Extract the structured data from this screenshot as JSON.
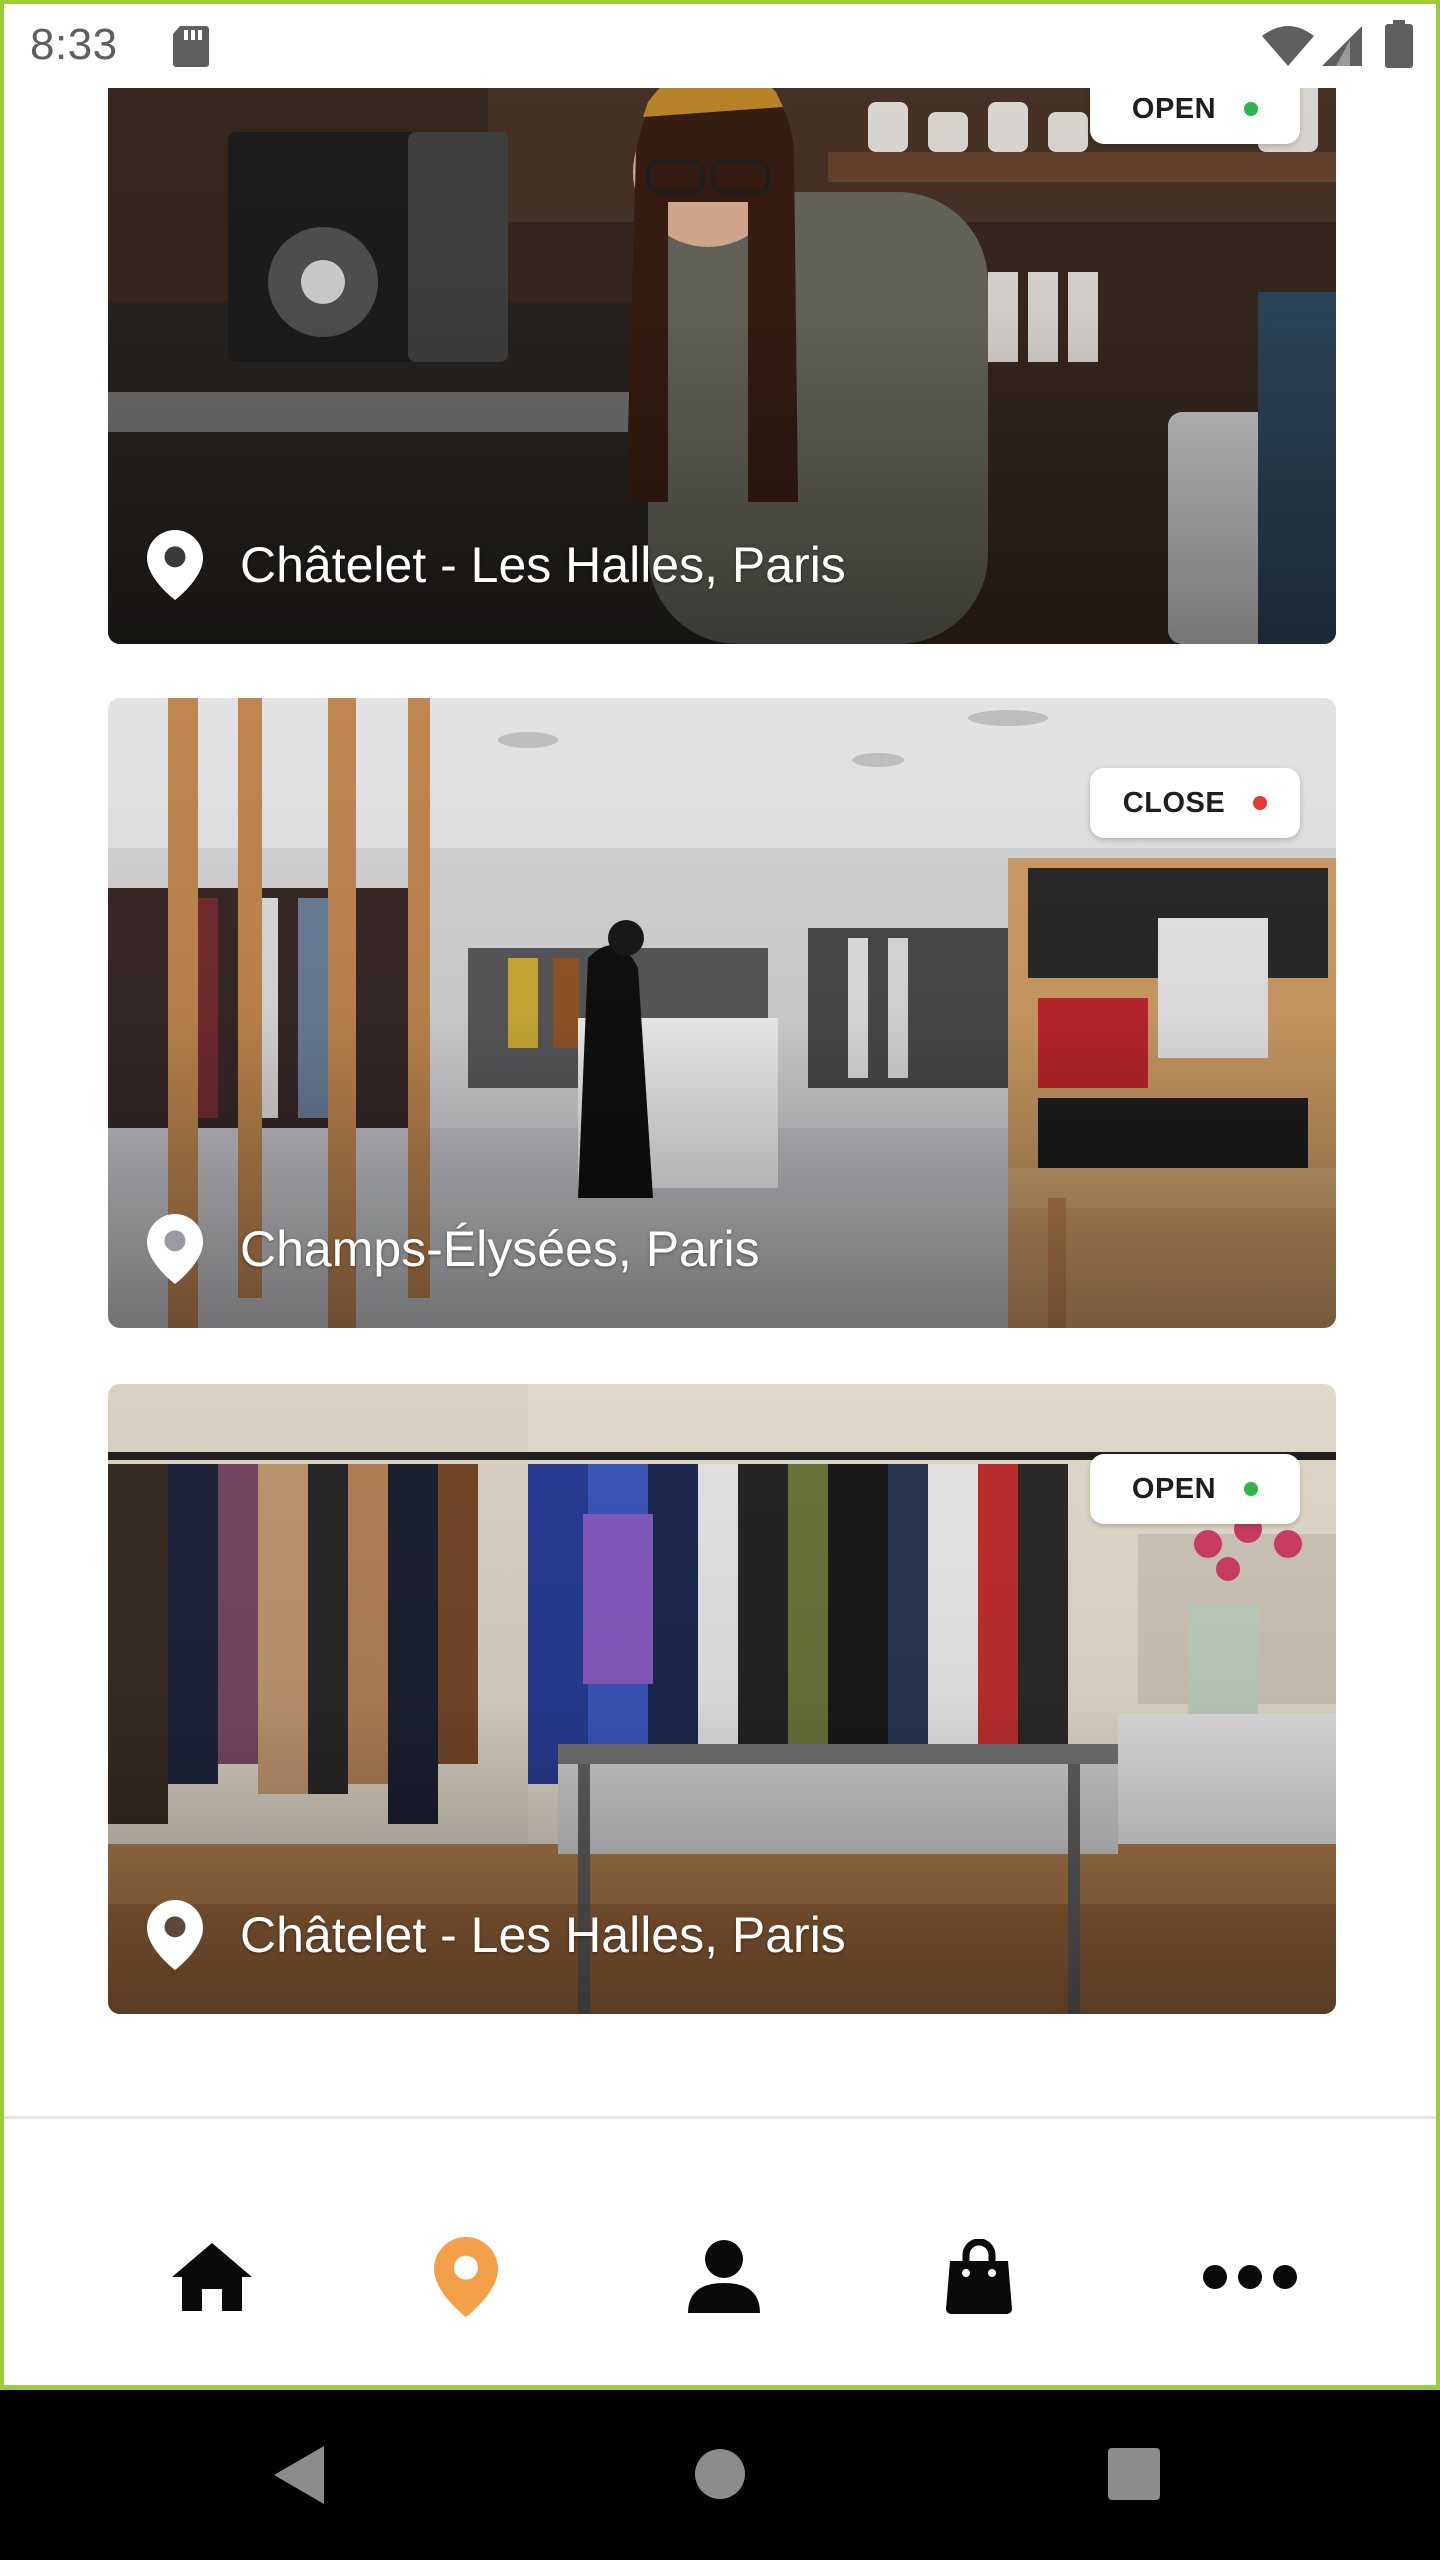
{
  "status_bar": {
    "time": "8:33",
    "icons": [
      "sd-card-icon",
      "wifi-icon",
      "cell-signal-icon",
      "battery-icon"
    ]
  },
  "stores": [
    {
      "location": "Châtelet - Les Halles, Paris",
      "status": "OPEN",
      "status_color": "#2fb34a",
      "image": "coffee-shop-barista-photo"
    },
    {
      "location": "Champs-Élysées, Paris",
      "status": "CLOSE",
      "status_color": "#e53935",
      "image": "clothing-boutique-interior-photo"
    },
    {
      "location": "Châtelet - Les Halles, Paris",
      "status": "OPEN",
      "status_color": "#2fb34a",
      "image": "clothing-racks-store-photo"
    }
  ],
  "bottom_nav": {
    "items": [
      {
        "icon": "home-icon",
        "active": false
      },
      {
        "icon": "map-pin-icon",
        "active": true
      },
      {
        "icon": "user-icon",
        "active": false
      },
      {
        "icon": "shopping-bag-icon",
        "active": false
      },
      {
        "icon": "more-icon",
        "active": false
      }
    ],
    "active_color": "#f2a14a",
    "inactive_color": "#0a0a0a"
  },
  "system_nav": {
    "buttons": [
      "back-icon",
      "home-circle-icon",
      "recents-icon"
    ]
  },
  "colors": {
    "frame_border": "#9ccc3c",
    "open_dot": "#2fb34a",
    "close_dot": "#e53935"
  }
}
